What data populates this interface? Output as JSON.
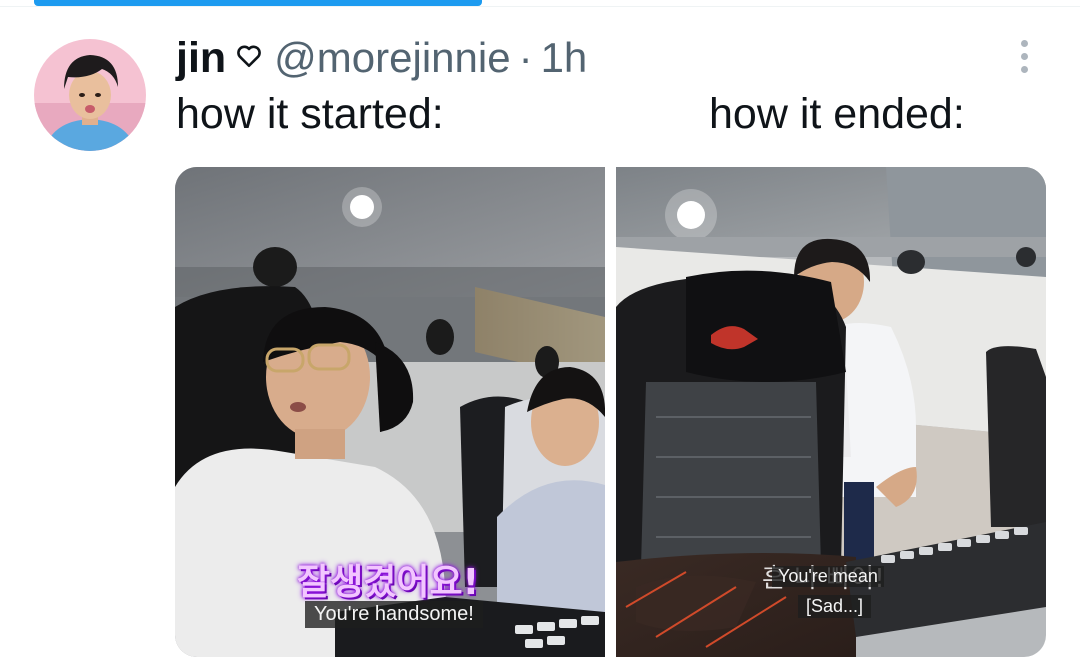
{
  "post": {
    "display_name": "jin",
    "name_icon": "heart-outline-icon",
    "handle": "@morejinnie",
    "separator": "·",
    "time": "1h",
    "more_icon": "vertical-ellipsis-icon",
    "avatar_icon": "profile-avatar"
  },
  "tweet": {
    "text_left": "how it started:",
    "text_right": "how it ended:"
  },
  "media": {
    "left_panel": {
      "subtitle_korean": "잘생겼어요!",
      "subtitle_english": "You're handsome!"
    },
    "right_panel": {
      "subtitle_korean": "흔 나 빠이!",
      "subtitle_english_1": "You're mean",
      "subtitle_english_2": "[Sad...]"
    }
  },
  "colors": {
    "progress_bar": "#1d9bf0",
    "name": "#0f1419",
    "meta": "#536471"
  }
}
